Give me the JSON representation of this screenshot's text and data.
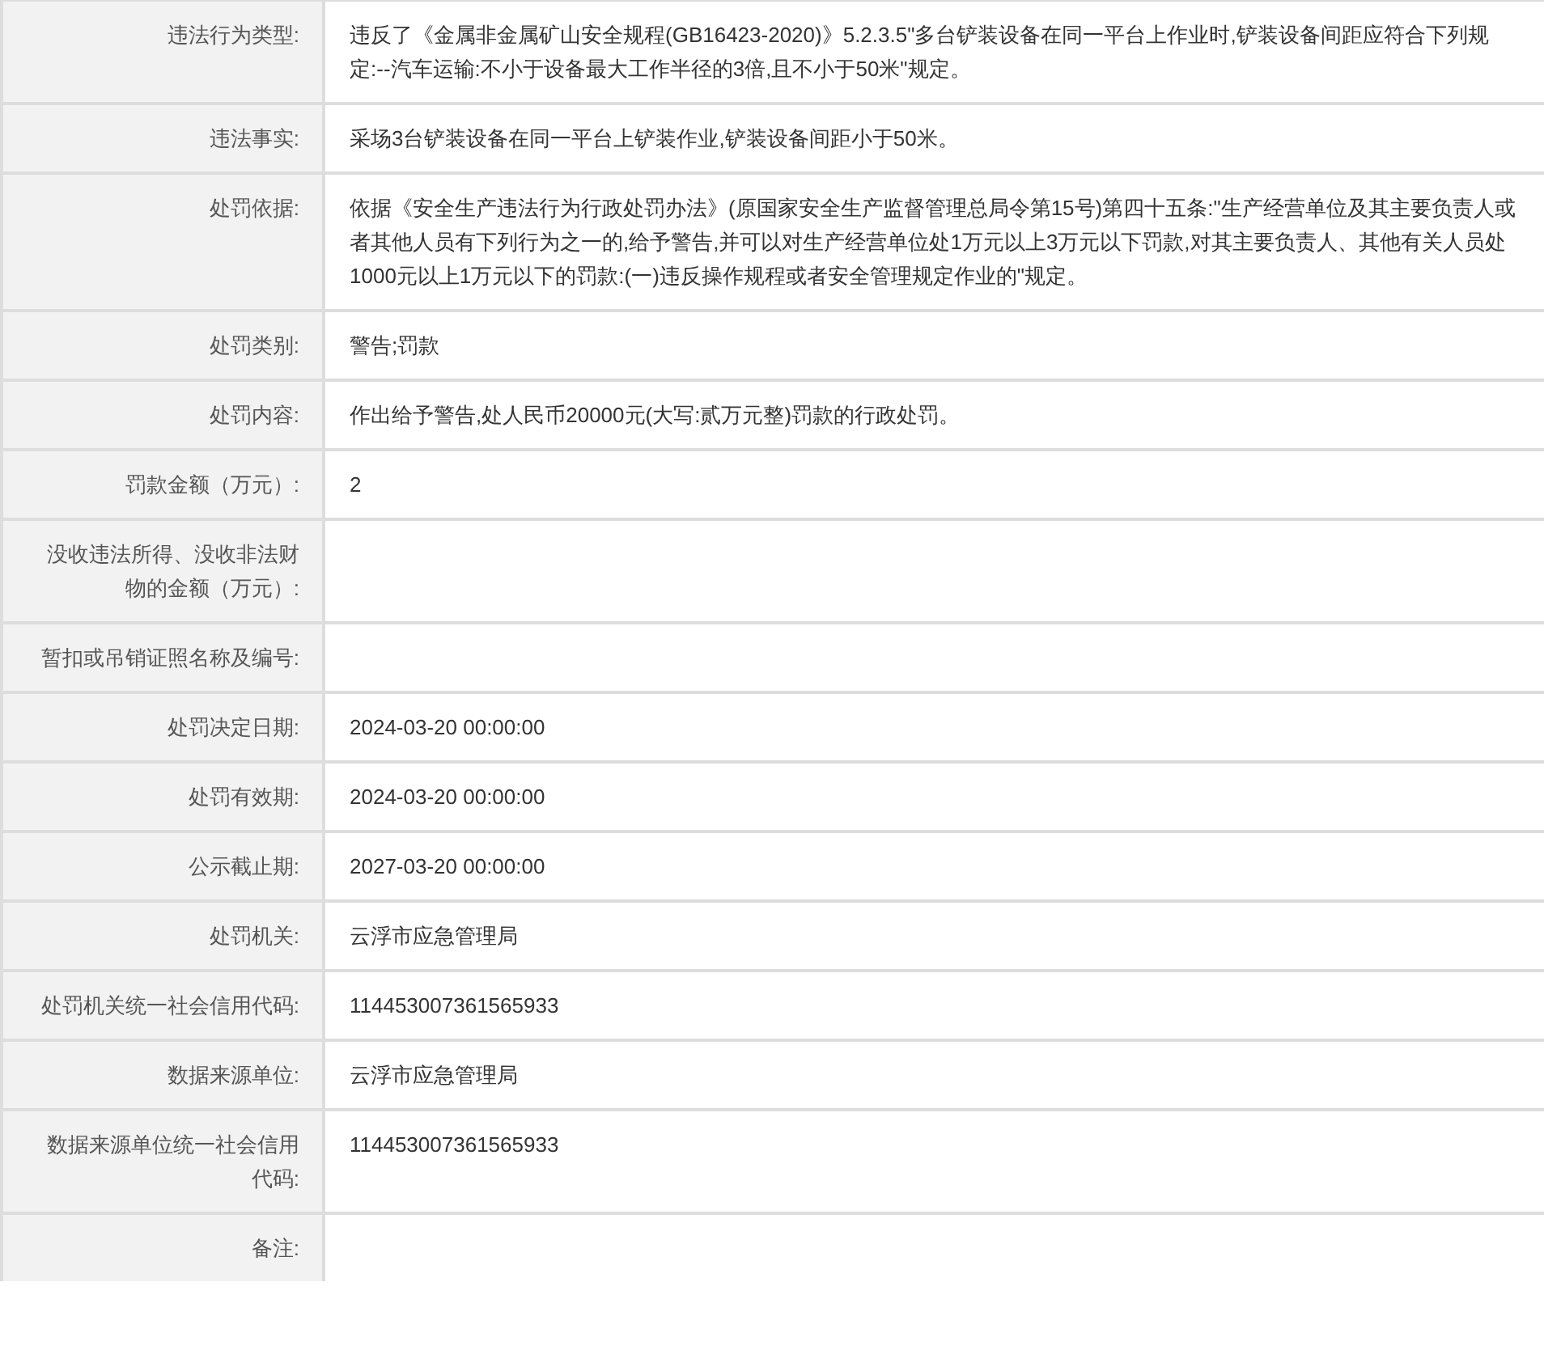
{
  "table": {
    "rows": [
      {
        "label": "违法行为类型:",
        "value": "违反了《金属非金属矿山安全规程(GB16423-2020)》5.2.3.5\"多台铲装设备在同一平台上作业时,铲装设备间距应符合下列规定:--汽车运输:不小于设备最大工作半径的3倍,且不小于50米\"规定。"
      },
      {
        "label": "违法事实:",
        "value": "采场3台铲装设备在同一平台上铲装作业,铲装设备间距小于50米。"
      },
      {
        "label": "处罚依据:",
        "value": "依据《安全生产违法行为行政处罚办法》(原国家安全生产监督管理总局令第15号)第四十五条:\"生产经营单位及其主要负责人或者其他人员有下列行为之一的,给予警告,并可以对生产经营单位处1万元以上3万元以下罚款,对其主要负责人、其他有关人员处1000元以上1万元以下的罚款:(一)违反操作规程或者安全管理规定作业的\"规定。"
      },
      {
        "label": "处罚类别:",
        "value": "警告;罚款"
      },
      {
        "label": "处罚内容:",
        "value": "作出给予警告,处人民币20000元(大写:贰万元整)罚款的行政处罚。"
      },
      {
        "label": "罚款金额（万元）:",
        "value": "2"
      },
      {
        "label": "没收违法所得、没收非法财物的金额（万元）:"
      },
      {
        "label": "暂扣或吊销证照名称及编号:"
      },
      {
        "label": "处罚决定日期:",
        "value": "2024-03-20 00:00:00"
      },
      {
        "label": "处罚有效期:",
        "value": "2024-03-20 00:00:00"
      },
      {
        "label": "公示截止期:",
        "value": "2027-03-20 00:00:00"
      },
      {
        "label": "处罚机关:",
        "value": "云浮市应急管理局"
      },
      {
        "label": "处罚机关统一社会信用代码:",
        "value": "114453007361565933"
      },
      {
        "label": "数据来源单位:",
        "value": "云浮市应急管理局"
      },
      {
        "label": "数据来源单位统一社会信用代码:",
        "value": "114453007361565933"
      },
      {
        "label": "备注:"
      }
    ]
  }
}
